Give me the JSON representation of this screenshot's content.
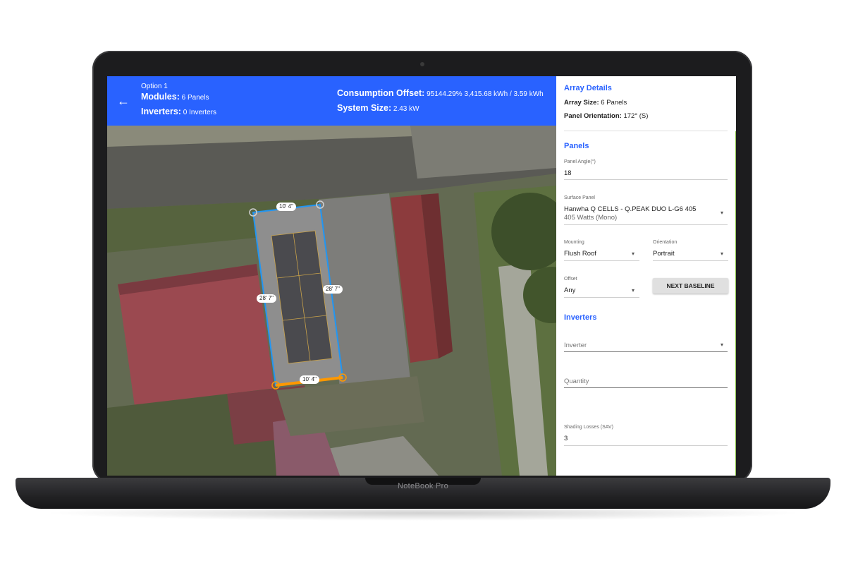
{
  "device": {
    "brand_label": "NoteBook Pro"
  },
  "header": {
    "option": "Option 1",
    "modules_label": "Modules:",
    "modules_value": "6 Panels",
    "inverters_label": "Inverters:",
    "inverters_value": "0 Inverters",
    "offset_label": "Consumption Offset:",
    "offset_value": "95144.29% 3,415.68 kWh / 3.59 kWh",
    "system_label": "System Size:",
    "system_value": "2.43 kW",
    "back_icon": "←"
  },
  "map": {
    "dims": {
      "top": "10' 4\"",
      "bottom": "10' 4\"",
      "left": "28' 7\"",
      "right": "28' 7\""
    }
  },
  "panel": {
    "array_title": "Array Details",
    "array_size_label": "Array Size:",
    "array_size_value": "6 Panels",
    "orientation_label": "Panel Orientation:",
    "orientation_value": "172° (S)",
    "panels_title": "Panels",
    "angle_label": "Panel Angle(°)",
    "angle_value": "18",
    "surface_label": "Surface Panel",
    "surface_value": "Hanwha Q CELLS - Q.PEAK DUO L-G6 405",
    "surface_sub": "405 Watts (Mono)",
    "mounting_label": "Mounting",
    "mounting_value": "Flush Roof",
    "orient_label": "Orientation",
    "orient_value": "Portrait",
    "offset_label": "Offset",
    "offset_value": "Any",
    "next_baseline": "NEXT BASELINE",
    "inverters_title": "Inverters",
    "inverter_placeholder": "Inverter",
    "quantity_placeholder": "Quantity",
    "shading_label": "Shading Losses (SAV)",
    "shading_value": "3",
    "caret": "▾"
  },
  "colors": {
    "accent": "#2962ff",
    "edge_selected": "#ff9800",
    "outline": "#2196f3"
  }
}
